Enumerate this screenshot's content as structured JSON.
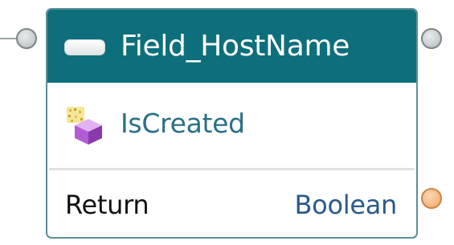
{
  "node": {
    "title": "Field_HostName",
    "header_icon": "textbox-field-icon",
    "method": {
      "label": "IsCreated",
      "icon": "method-cube-icon"
    },
    "return": {
      "label": "Return",
      "type": "Boolean"
    }
  },
  "ports": {
    "input": "exec-in-port",
    "output": "exec-out-port",
    "return": "return-value-port"
  },
  "colors": {
    "header": "#0e6f7c",
    "border": "#5b8f96",
    "method_text": "#2a6f86",
    "type_text": "#2a5a8a",
    "return_port": "#f1a766",
    "exec_port": "#b6bcbd"
  }
}
